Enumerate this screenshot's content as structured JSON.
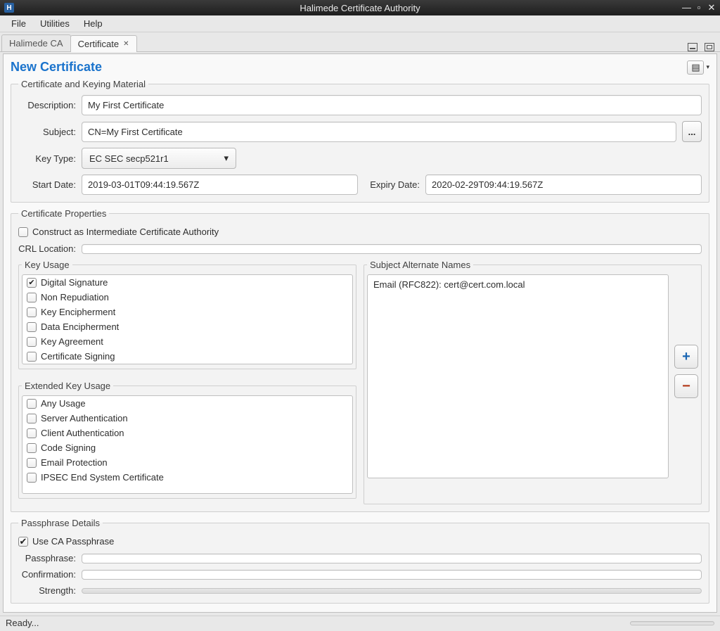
{
  "window": {
    "title": "Halimede Certificate Authority",
    "app_icon_letter": "H"
  },
  "menubar": {
    "file": "File",
    "utilities": "Utilities",
    "help": "Help"
  },
  "tabs": {
    "left": "Halimede CA",
    "active": "Certificate"
  },
  "editor": {
    "title": "New Certificate"
  },
  "material": {
    "legend": "Certificate and Keying Material",
    "description_lbl": "Description:",
    "description_val": "My First Certificate",
    "subject_lbl": "Subject:",
    "subject_val": "CN=My First Certificate",
    "subject_btn": "...",
    "keytype_lbl": "Key Type:",
    "keytype_val": "EC SEC secp521r1",
    "start_lbl": "Start Date:",
    "start_val": "2019-03-01T09:44:19.567Z",
    "expiry_lbl": "Expiry Date:",
    "expiry_val": "2020-02-29T09:44:19.567Z"
  },
  "props": {
    "legend": "Certificate Properties",
    "intermediate": "Construct as Intermediate Certificate Authority",
    "crl_lbl": "CRL Location:",
    "crl_val": "",
    "keyusage_legend": "Key Usage",
    "keyusage": [
      {
        "label": "Digital Signature",
        "checked": true
      },
      {
        "label": "Non Repudiation",
        "checked": false
      },
      {
        "label": "Key Encipherment",
        "checked": false
      },
      {
        "label": "Data Encipherment",
        "checked": false
      },
      {
        "label": "Key Agreement",
        "checked": false
      },
      {
        "label": "Certificate Signing",
        "checked": false
      }
    ],
    "extusage_legend": "Extended Key Usage",
    "extusage": [
      {
        "label": "Any Usage",
        "checked": false
      },
      {
        "label": "Server Authentication",
        "checked": false
      },
      {
        "label": "Client Authentication",
        "checked": false
      },
      {
        "label": "Code Signing",
        "checked": false
      },
      {
        "label": "Email Protection",
        "checked": false
      },
      {
        "label": "IPSEC End System Certificate",
        "checked": false
      }
    ],
    "san_legend": "Subject Alternate Names",
    "san_items": [
      "Email (RFC822): cert@cert.com.local"
    ]
  },
  "passphrase": {
    "legend": "Passphrase Details",
    "useca": "Use CA Passphrase",
    "useca_checked": true,
    "pass_lbl": "Passphrase:",
    "conf_lbl": "Confirmation:",
    "strength_lbl": "Strength:"
  },
  "statusbar": {
    "text": "Ready..."
  },
  "glyphs": {
    "check": "✔",
    "caret": "▾",
    "close": "✕",
    "plus": "+",
    "minus": "−",
    "wm_min": "—",
    "wm_max": "▫",
    "wm_close": "✕"
  }
}
